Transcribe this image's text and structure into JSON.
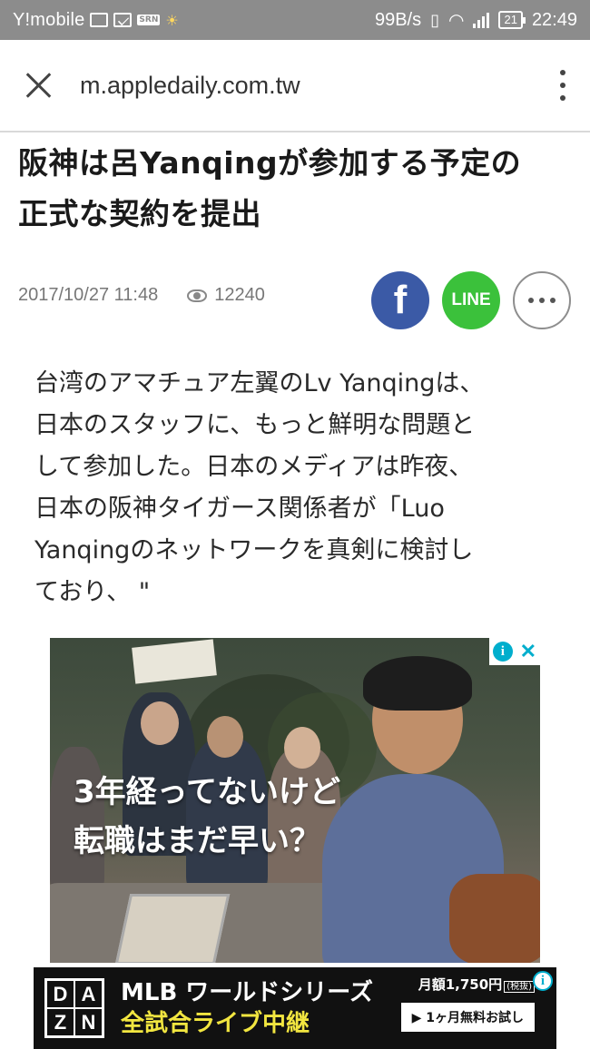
{
  "status_bar": {
    "carrier": "Y!mobile",
    "net_speed": "99B/s",
    "battery": "21",
    "time": "22:49"
  },
  "browser": {
    "url": "m.appledaily.com.tw"
  },
  "article": {
    "title_line1": "阪神は呂Yanqingが参加する予定の",
    "title_line2": "正式な契約を提出",
    "date": "2017/10/27 11:48",
    "views": "12240",
    "share": {
      "facebook_label": "f",
      "line_label": "LINE"
    },
    "body_lines": [
      "台湾のアマチュア左翼のLv Yanqingは、",
      "日本のスタッフに、もっと鮮明な問題と",
      "して参加した。日本のメディアは昨夜、",
      "日本の阪神タイガース関係者が「Luo",
      "Yanqingのネットワークを真剣に検討し",
      "ており、 \""
    ]
  },
  "ad1": {
    "copy_line1": "3年経ってないけど",
    "copy_line2": "転職はまだ早い？",
    "choices_i": "i",
    "choices_x": "✕"
  },
  "ad2": {
    "logo": [
      "D",
      "A",
      "Z",
      "N"
    ],
    "line1": "MLB ワールドシリーズ",
    "line2": "全試合ライブ中継",
    "price": "月額1,750円",
    "price_note": "(税抜)",
    "cta": "▶ 1ヶ月無料お試し",
    "info": "i"
  },
  "colors": {
    "facebook": "#3b5aa6",
    "line": "#3bc13b",
    "status_bar": "#8c8c8c"
  }
}
